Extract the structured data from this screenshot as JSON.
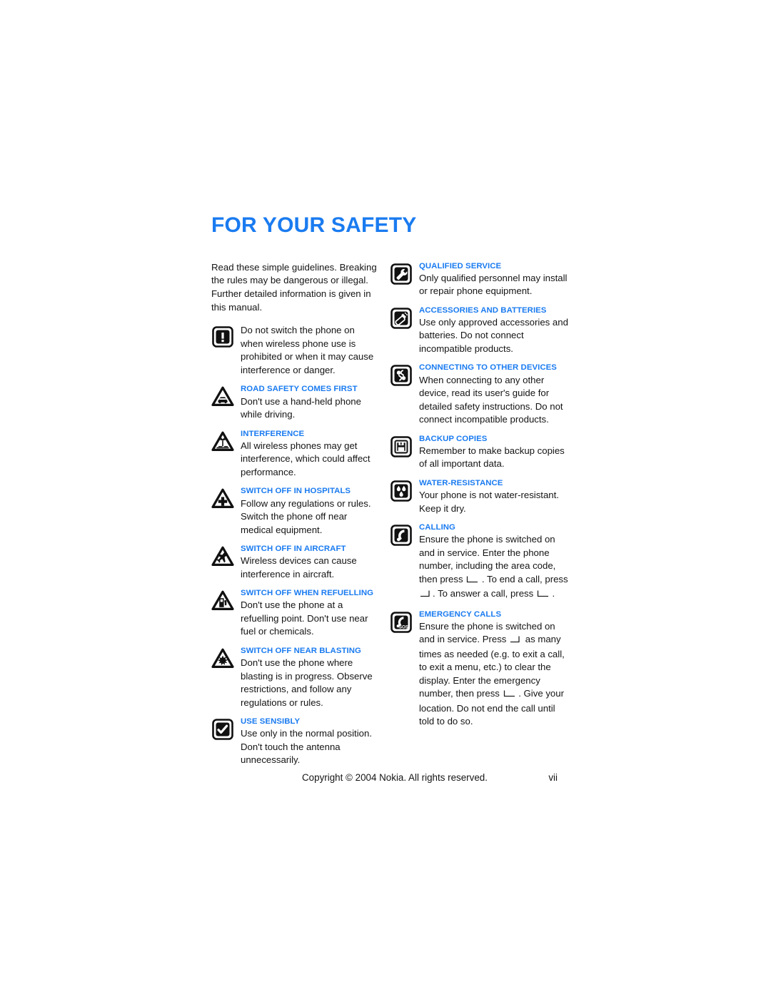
{
  "document": {
    "title": "FOR YOUR SAFETY",
    "title_color": "#1a7bf0",
    "intro": "Read these simple guidelines. Breaking the rules may be dangerous or illegal. Further detailed information is given in this manual."
  },
  "left_column": [
    {
      "icon": "exclamation-square-icon",
      "heading": "",
      "text": "Do not switch the phone on when wireless phone use is prohibited or when it may cause interference or danger."
    },
    {
      "icon": "road-safety-triangle-icon",
      "heading": "ROAD SAFETY COMES FIRST",
      "text": "Don't use a hand-held phone while driving."
    },
    {
      "icon": "interference-triangle-icon",
      "heading": "INTERFERENCE",
      "text": "All wireless phones may get interference, which could affect performance."
    },
    {
      "icon": "hospital-triangle-icon",
      "heading": "SWITCH OFF IN HOSPITALS",
      "text": "Follow any regulations or rules. Switch the phone off near medical equipment."
    },
    {
      "icon": "aircraft-triangle-icon",
      "heading": "SWITCH OFF IN AIRCRAFT",
      "text": "Wireless devices can cause interference in aircraft."
    },
    {
      "icon": "refuelling-triangle-icon",
      "heading": "SWITCH OFF WHEN REFUELLING",
      "text": "Don't use the phone at a refuelling point. Don't use near fuel or chemicals."
    },
    {
      "icon": "blasting-triangle-icon",
      "heading": "SWITCH OFF NEAR BLASTING",
      "text": "Don't use the phone where blasting is in progress. Observe restrictions, and follow any regulations or rules."
    },
    {
      "icon": "checkmark-square-icon",
      "heading": "USE SENSIBLY",
      "text": "Use only in the normal position. Don't touch the antenna unnecessarily."
    }
  ],
  "right_column": [
    {
      "icon": "wrench-square-icon",
      "heading": "QUALIFIED SERVICE",
      "text": "Only qualified personnel may install or repair phone equipment."
    },
    {
      "icon": "battery-accessory-square-icon",
      "heading": "ACCESSORIES AND BATTERIES",
      "text": "Use only approved accessories and batteries. Do not connect incompatible products."
    },
    {
      "icon": "connector-plug-square-icon",
      "heading": "CONNECTING TO OTHER DEVICES",
      "text": "When connecting to any other device, read its user's guide for detailed safety instructions. Do not connect incompatible products."
    },
    {
      "icon": "floppy-disk-square-icon",
      "heading": "BACKUP COPIES",
      "text": "Remember to make backup copies of all important data."
    },
    {
      "icon": "water-drops-square-icon",
      "heading": "WATER-RESISTANCE",
      "text": "Your phone is not water-resistant. Keep it dry."
    },
    {
      "icon": "handset-square-icon",
      "heading": "CALLING",
      "text_parts": [
        "Ensure the phone is switched on and in service. Enter the phone number, including the area code, then press ",
        "[call-key]",
        " . To end a call, press ",
        "[end-key]",
        ". To answer a call, press ",
        "[call-key]",
        " ."
      ]
    },
    {
      "icon": "sos-handset-square-icon",
      "heading": "EMERGENCY CALLS",
      "text_parts": [
        "Ensure the phone is switched on and in service. Press ",
        "[end-key]",
        " as many times as needed (e.g. to exit a call, to exit a menu, etc.) to clear the display. Enter the emergency number, then press ",
        "[call-key]",
        " . Give your location. Do not end the call until told to do so."
      ]
    }
  ],
  "footer": {
    "copyright": "Copyright © 2004 Nokia. All rights reserved.",
    "page_number": "vii"
  }
}
